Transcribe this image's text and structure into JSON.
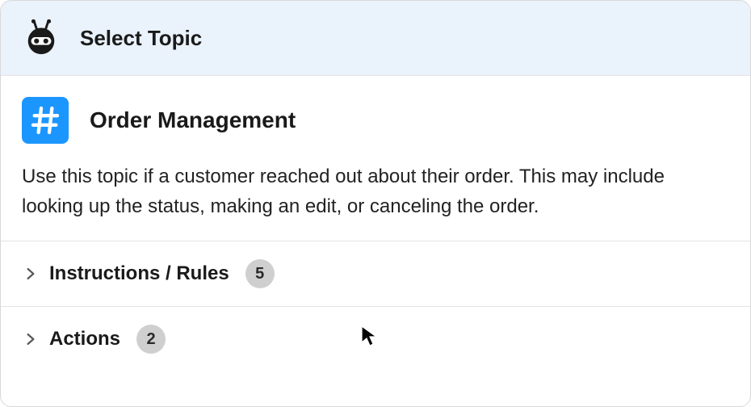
{
  "header": {
    "title": "Select Topic"
  },
  "topic": {
    "title": "Order Management",
    "description": "Use this topic if a customer reached out about their order. This may include looking up the status, making an edit, or canceling the order."
  },
  "accordion": {
    "instructions": {
      "label": "Instructions / Rules",
      "count": "5"
    },
    "actions": {
      "label": "Actions",
      "count": "2"
    }
  }
}
